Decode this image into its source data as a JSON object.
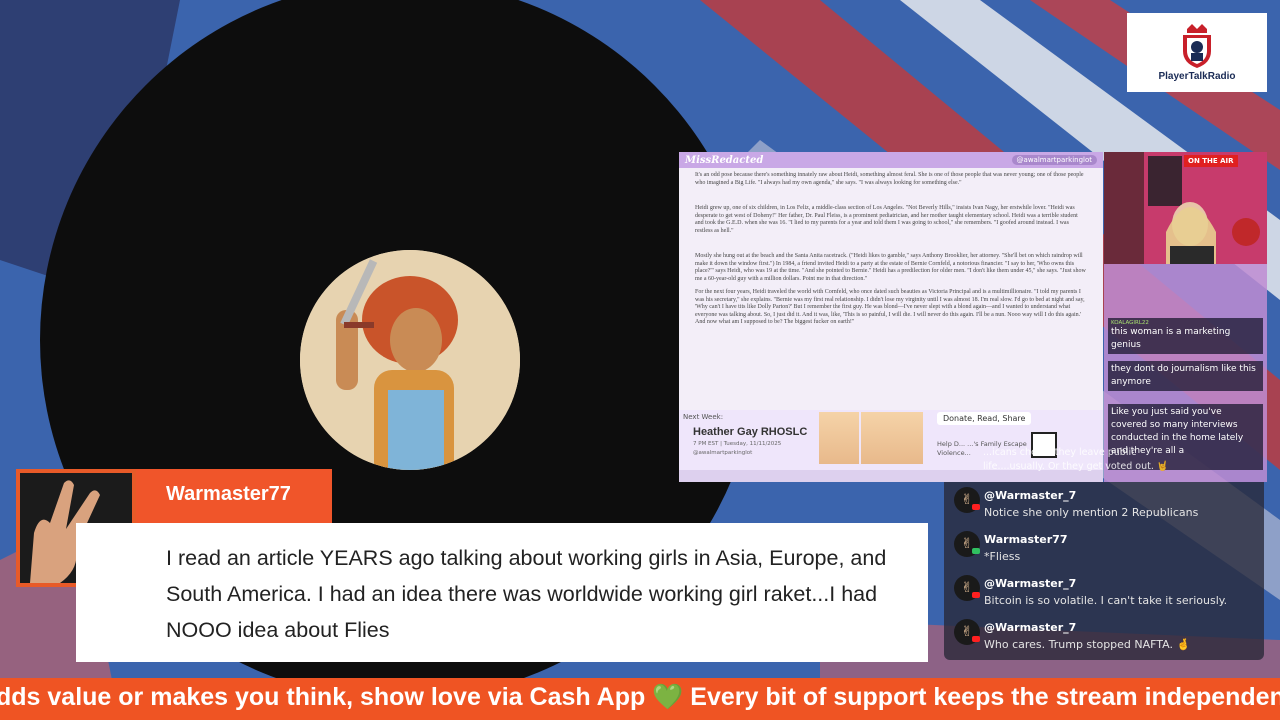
{
  "logo": {
    "name": "PlayerTalkRadio",
    "icon": "crowned-shield-logo"
  },
  "article": {
    "brand": "MissRedacted",
    "handle": "@awalmartparkinglot",
    "paragraphs": [
      "It's an odd pose because there's something innately raw about Heidi, something almost feral. She is one of those people that was never young; one of those people who imagined a Big Life. \"I always had my own agenda,\" she says. \"I was always looking for something else.\"",
      "Heidi grew up, one of six children, in Los Feliz, a middle-class section of Los Angeles. \"Not Beverly Hills,\" insists Ivan Nagy, her erstwhile lover. \"Heidi was desperate to get west of Doheny!\" Her father, Dr. Paul Fleiss, is a prominent pediatrician, and her mother taught elementary school. Heidi was a terrible student and took the G.E.D. when she was 16. \"I lied to my parents for a year and told them I was going to school,\" she remembers. \"I goofed around instead. I was restless as hell.\"",
      "Mostly she hung out at the beach and the Santa Anita racetrack. (\"Heidi likes to gamble,\" says Anthony Brooklier, her attorney. \"She'll bet on which raindrop will make it down the window first.\") In 1984, a friend invited Heidi to a party at the estate of Bernie Cornfeld, a notorious financier. \"I say to her, 'Who owns this place?'\" says Heidi, who was 19 at the time. \"And she pointed to Bernie.\" Heidi has a predilection for older men. \"I don't like them under 45,\" she says. \"Just show me a 60-year-old guy with a million dollars. Point me in that direction.\"",
      "For the next four years, Heidi traveled the world with Cornfeld, who once dated such beauties as Victoria Principal and is a multimillionaire. \"I told my parents I was his secretary,\" she explains. \"Bernie was my first real relationship. I didn't lose my virginity until I was almost 18. I'm real slow. I'd go to bed at night and say, 'Why can't I have tits like Dolly Parton?' But I remember the first guy. He was blond—I've never slept with a blond again—and I wanted to understand what everyone was talking about. So, I just did it. And it was, like, 'This is so painful, I will die. I will never do this again. I'll be a nun. Nooo way will I do this again.' And now what am I supposed to be? The biggest fucker on earth!\""
    ]
  },
  "panel": {
    "next_label": "Next Week:",
    "guest": "Heather Gay RHOSLC",
    "date": "7 PM EST | Tuesday, 11/11/2025",
    "handle": "@awalmartparkinglot",
    "donate": "Donate, Read, Share",
    "help": "Help D... ...'s Family Escape Violence..."
  },
  "cam": {
    "on_air": "ON THE AIR"
  },
  "side_chat": [
    {
      "user": "KOALAGIRL22",
      "text": "this woman is a marketing genius"
    },
    {
      "user": "",
      "text": "they dont do journalism like this anymore"
    },
    {
      "user": "",
      "text": "Like you just said you've covered so many interviews conducted in the home lately and they're all a"
    }
  ],
  "overlay_tail": "...icans chea... they leave public life....usually. Or they get voted out. 🤘",
  "chat": [
    {
      "user": "@Warmaster_7",
      "text": "Notice she only mention 2 Republicans"
    },
    {
      "user": "Warmaster77",
      "text": "*Fliess"
    },
    {
      "user": "@Warmaster_7",
      "text": "Bitcoin is so volatile. I can't take it seriously."
    },
    {
      "user": "@Warmaster_7",
      "text": "Who cares. Trump stopped NAFTA. 🤞"
    }
  ],
  "featured": {
    "name": "Warmaster77",
    "comment": "I read an article YEARS ago talking about working girls in Asia, Europe, and South America. I had an idea there was worldwide working girl raket...I had NOOO idea about Flies"
  },
  "ticker": {
    "text": "dds value or makes you think, show love via Cash App 💚 Every bit of support keeps the stream independent"
  },
  "colors": {
    "accent": "#ef5423",
    "record": "#0d0d0d",
    "lavender": "#c9a8e6"
  }
}
